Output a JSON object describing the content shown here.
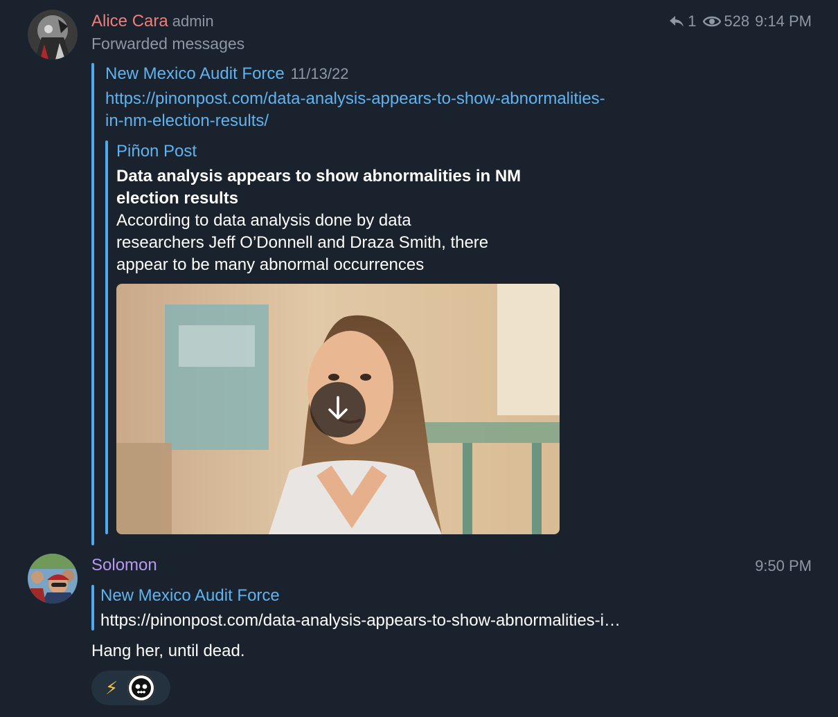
{
  "message1": {
    "sender_name": "Alice Cara",
    "sender_role": "admin",
    "forward_label": "Forwarded messages",
    "reply_count": "1",
    "view_count": "528",
    "time": "9:14 PM",
    "forwarded": {
      "source_name": "New Mexico Audit Force",
      "date": "11/13/22",
      "url_line1": "https://pinonpost.com/data-analysis-appears-to-show-abnormalities-",
      "url_line2": "in-nm-election-results/",
      "preview": {
        "site_name": "Piñon Post",
        "title_line1": "Data analysis appears to show abnormalities in NM",
        "title_line2": "election results",
        "desc_line1": "According to data analysis done by data",
        "desc_line2": "researchers  Jeff O’Donnell and Draza Smith, there",
        "desc_line3": "appear to be many abnormal occurrences"
      }
    }
  },
  "message2": {
    "sender_name": "Solomon",
    "time": "9:50 PM",
    "reply": {
      "source_name": "New Mexico Audit Force",
      "text": "https://pinonpost.com/data-analysis-appears-to-show-abnormalities-i…"
    },
    "body": "Hang her, until dead.",
    "reaction": {
      "emoji": "⚡"
    }
  },
  "colors": {
    "background": "#19222d",
    "name_alice": "#f07f7a",
    "name_solomon": "#b899f2",
    "link": "#5fb3f0",
    "quote_bar": "#4fa9ee",
    "meta": "#8d98a4"
  }
}
